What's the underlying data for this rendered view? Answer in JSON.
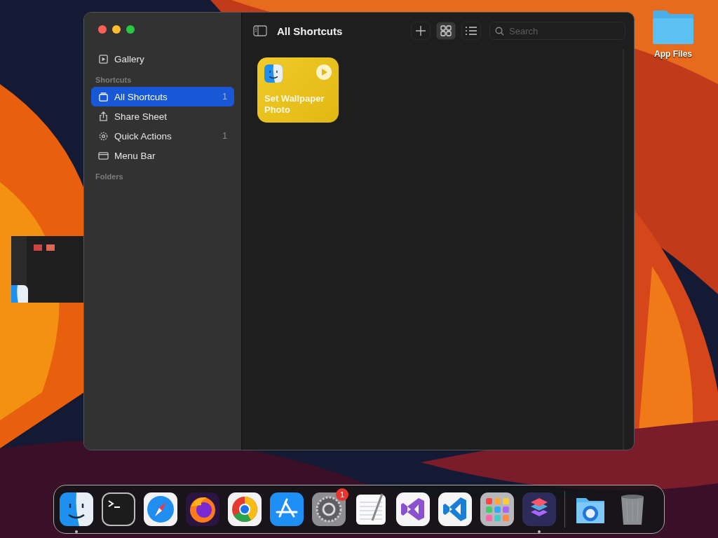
{
  "window": {
    "title": "All Shortcuts",
    "search": {
      "placeholder": "Search"
    },
    "view_buttons": [
      {
        "kind": "grid",
        "selected": true
      },
      {
        "kind": "list",
        "selected": false
      }
    ]
  },
  "sidebar": {
    "top": [
      {
        "label": "Gallery",
        "kind": "gallery",
        "selected": false
      }
    ],
    "sections": [
      {
        "title": "Shortcuts",
        "items": [
          {
            "label": "All Shortcuts",
            "kind": "stack",
            "count": "1",
            "selected": true
          },
          {
            "label": "Share Sheet",
            "kind": "share",
            "selected": false
          },
          {
            "label": "Quick Actions",
            "kind": "gear",
            "count": "1",
            "selected": false
          },
          {
            "label": "Menu Bar",
            "kind": "menubar",
            "selected": false
          }
        ]
      },
      {
        "title": "Folders"
      }
    ]
  },
  "shortcuts": [
    {
      "title": "Set Wallpaper Photo"
    }
  ],
  "desktop_icons": [
    {
      "label": "App Files"
    }
  ],
  "dock": [
    {
      "kind": "finder",
      "running": true
    },
    {
      "kind": "terminal",
      "running": false
    },
    {
      "kind": "safari",
      "running": false
    },
    {
      "kind": "firefox",
      "running": false
    },
    {
      "kind": "chrome",
      "running": false
    },
    {
      "kind": "appstore",
      "running": false
    },
    {
      "kind": "settings",
      "running": false,
      "badge": "1"
    },
    {
      "kind": "textedit",
      "running": false
    },
    {
      "kind": "vs",
      "running": false
    },
    {
      "kind": "vscode",
      "running": false
    },
    {
      "kind": "launchpad",
      "running": false
    },
    {
      "kind": "shortcuts",
      "running": true
    },
    {
      "kind": "separator"
    },
    {
      "kind": "folder",
      "running": false
    },
    {
      "kind": "trash",
      "running": false
    }
  ]
}
